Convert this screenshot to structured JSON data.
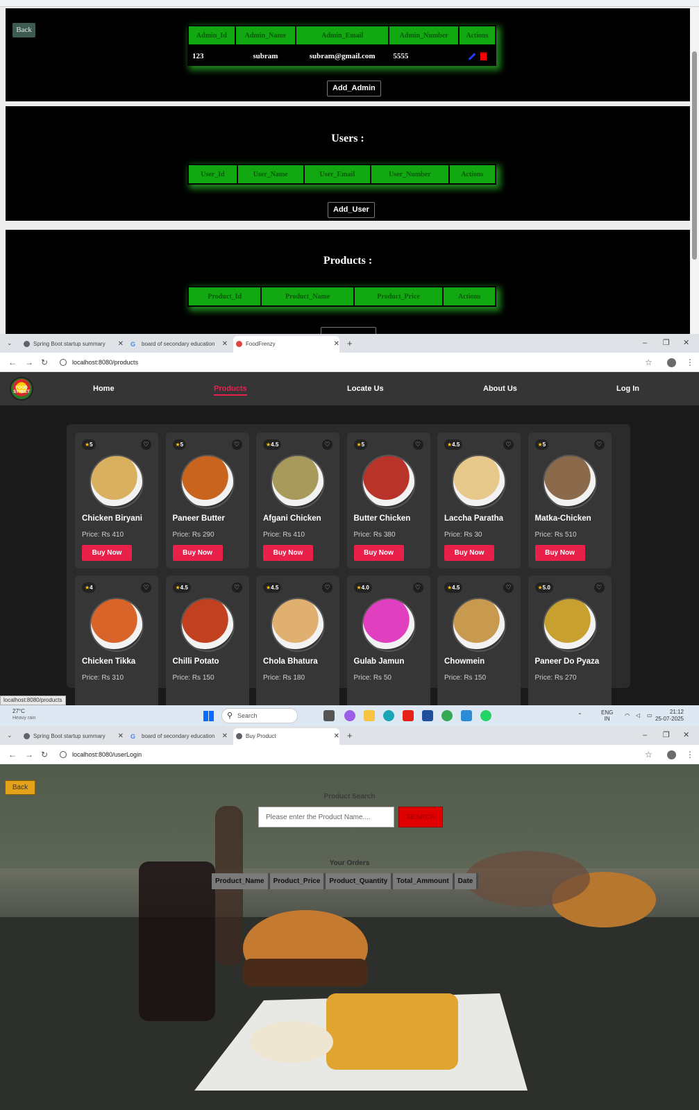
{
  "admin_page": {
    "back_label": "Back",
    "admins_table": {
      "headers": [
        "Admin_Id",
        "Admin_Name",
        "Admin_Email",
        "Admin_Number",
        "Actions"
      ],
      "rows": [
        {
          "id": "123",
          "name": "subram",
          "email": "subram@gmail.com",
          "number": "5555"
        }
      ]
    },
    "add_admin_label": "Add_Admin",
    "users_title": "Users :",
    "users_table": {
      "headers": [
        "User_Id",
        "User_Name",
        "User_Email",
        "User_Number",
        "Actions"
      ]
    },
    "add_user_label": "Add_User",
    "products_title": "Products :",
    "products_table": {
      "headers": [
        "Product_Id",
        "Product_Name",
        "Product_Price",
        "Actions"
      ]
    }
  },
  "browser1": {
    "tabs": [
      {
        "label": "Spring Boot startup summary"
      },
      {
        "label": "board of secondary education"
      },
      {
        "label": "FoodFrenzy"
      }
    ],
    "url": "localhost:8080/products"
  },
  "products_page": {
    "logo_text": "FOOD STREET",
    "nav": [
      {
        "label": "Home"
      },
      {
        "label": "Products"
      },
      {
        "label": "Locate Us"
      },
      {
        "label": "About Us"
      },
      {
        "label": "Log In"
      }
    ],
    "buy_label": "Buy Now",
    "items": [
      {
        "rating": "5",
        "name": "Chicken Biryani",
        "price": "Price: Rs 410",
        "color": "#d9b060"
      },
      {
        "rating": "5",
        "name": "Paneer Butter",
        "price": "Price: Rs 290",
        "color": "#c8641e"
      },
      {
        "rating": "4.5",
        "name": "Afgani Chicken",
        "price": "Price: Rs 410",
        "color": "#a89a5a"
      },
      {
        "rating": "5",
        "name": "Butter Chicken",
        "price": "Price: Rs 380",
        "color": "#b8332a"
      },
      {
        "rating": "4.5",
        "name": "Laccha Paratha",
        "price": "Price: Rs 30",
        "color": "#e8c98c"
      },
      {
        "rating": "5",
        "name": "Matka-Chicken",
        "price": "Price: Rs 510",
        "color": "#8a6a4a"
      },
      {
        "rating": "4",
        "name": "Chicken Tikka",
        "price": "Price: Rs 310",
        "color": "#d8642a"
      },
      {
        "rating": "4.5",
        "name": "Chilli Potato",
        "price": "Price: Rs 150",
        "color": "#c04020"
      },
      {
        "rating": "4.5",
        "name": "Chola Bhatura",
        "price": "Price: Rs 180",
        "color": "#e0b070"
      },
      {
        "rating": "4.0",
        "name": "Gulab Jamun",
        "price": "Price: Rs 50",
        "color": "#e040c0"
      },
      {
        "rating": "4.5",
        "name": "Chowmein",
        "price": "Price: Rs 150",
        "color": "#c89a50"
      },
      {
        "rating": "5.0",
        "name": "Paneer Do Pyaza",
        "price": "Price: Rs 270",
        "color": "#c8a030"
      }
    ],
    "status_url": "localhost:8080/products"
  },
  "taskbar": {
    "temperature": "27°C",
    "weather": "Heavy rain",
    "search_label": "Search",
    "language": "ENG",
    "region": "IN",
    "time": "21:12",
    "date": "25-07-2025"
  },
  "browser2": {
    "tabs": [
      {
        "label": "Spring Boot startup summary"
      },
      {
        "label": "board of secondary education"
      },
      {
        "label": "Buy Product"
      }
    ],
    "url": "localhost:8080/userLogin"
  },
  "orders_page": {
    "back_label": "Back",
    "search_title": "Product Search",
    "search_placeholder": "Please enter the Product Name....",
    "search_button": "SEARCH",
    "orders_title": "Your Orders",
    "orders_headers": [
      "Product_Name",
      "Product_Price",
      "Product_Quantity",
      "Total_Ammount",
      "Date"
    ]
  },
  "colors": {
    "accent_green": "#11a811",
    "accent_red": "#e8204a",
    "search_red": "#e00000"
  }
}
